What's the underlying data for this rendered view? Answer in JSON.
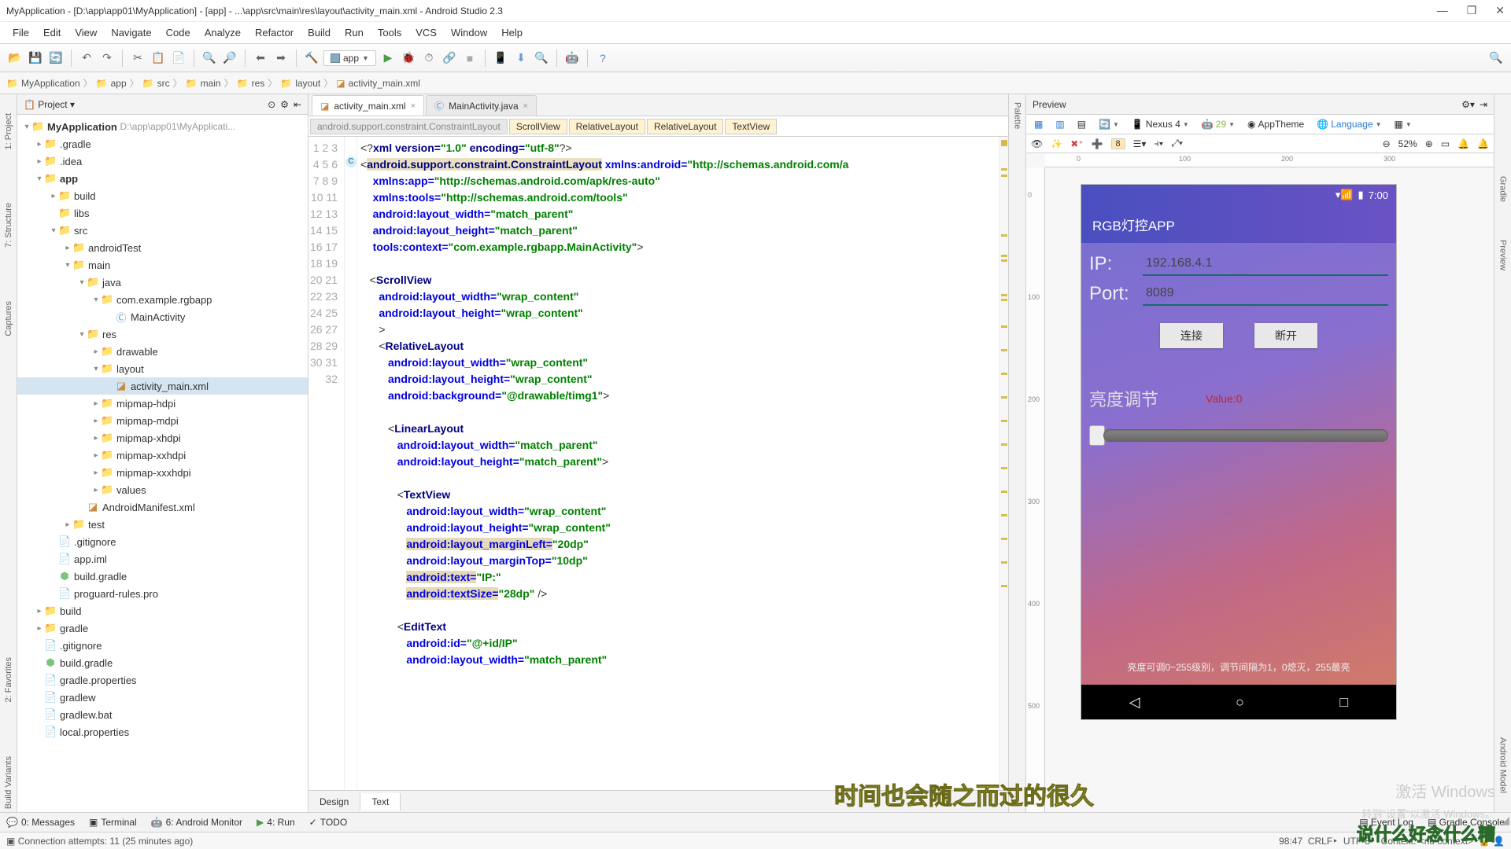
{
  "window": {
    "title": "MyApplication - [D:\\app\\app01\\MyApplication] - [app] - ...\\app\\src\\main\\res\\layout\\activity_main.xml - Android Studio 2.3",
    "min": "—",
    "max": "❐",
    "close": "✕"
  },
  "menu": [
    "File",
    "Edit",
    "View",
    "Navigate",
    "Code",
    "Analyze",
    "Refactor",
    "Build",
    "Run",
    "Tools",
    "VCS",
    "Window",
    "Help"
  ],
  "module": "app",
  "breadcrumbs": [
    "MyApplication",
    "app",
    "src",
    "main",
    "res",
    "layout",
    "activity_main.xml"
  ],
  "project": {
    "header": "Project",
    "root": "MyApplication",
    "rootPath": "D:\\app\\app01\\MyApplicati...",
    "items": [
      ".gradle",
      ".idea",
      "app",
      "build",
      "libs",
      "src",
      "androidTest",
      "main",
      "java",
      "com.example.rgbapp",
      "MainActivity",
      "res",
      "drawable",
      "layout",
      "activity_main.xml",
      "mipmap-hdpi",
      "mipmap-mdpi",
      "mipmap-xhdpi",
      "mipmap-xxhdpi",
      "mipmap-xxxhdpi",
      "values",
      "AndroidManifest.xml",
      "test",
      ".gitignore",
      "app.iml",
      "build.gradle",
      "proguard-rules.pro",
      "build",
      "gradle",
      ".gitignore",
      "build.gradle",
      "gradle.properties",
      "gradlew",
      "gradlew.bat",
      "local.properties"
    ]
  },
  "editorTabs": [
    {
      "label": "activity_main.xml",
      "active": true,
      "icon": "xml"
    },
    {
      "label": "MainActivity.java",
      "active": false,
      "icon": "java"
    }
  ],
  "editorCrumbs": [
    "android.support.constraint.ConstraintLayout",
    "ScrollView",
    "RelativeLayout",
    "RelativeLayout",
    "TextView"
  ],
  "designTabs": {
    "design": "Design",
    "text": "Text"
  },
  "preview": {
    "title": "Preview",
    "device": "Nexus 4",
    "api": "29",
    "theme": "AppTheme",
    "lang": "Language",
    "zoom": "52%",
    "warn": "8",
    "phone": {
      "time": "7:00",
      "appTitle": "RGB灯控APP",
      "ipLabel": "IP:",
      "ipValue": "192.168.4.1",
      "portLabel": "Port:",
      "portValue": "8089",
      "btnConnect": "连接",
      "btnDisconnect": "断开",
      "brightness": "亮度调节",
      "valueLabel": "Value:0",
      "hint": "亮度可调0~255级别，调节间隔为1，0熄灭，255最亮"
    }
  },
  "bottomTabs": {
    "messages": "0: Messages",
    "terminal": "Terminal",
    "monitor": "6: Android Monitor",
    "run": "4: Run",
    "todo": "TODO"
  },
  "status": {
    "msg": "Connection attempts: 11 (25 minutes ago)",
    "pos": "98:47",
    "le": "CRLF",
    "enc": "UTF-8",
    "context": "Context: <no context>"
  },
  "leftTabs": [
    "1: Project",
    "7: Structure",
    "Captures",
    "2: Favorites",
    "Build Variants"
  ],
  "rightTabs": [
    "Gradle",
    "Preview",
    "Android Model"
  ],
  "overlay": {
    "t1": "时间也会随之而过的很久",
    "t2": "激活 Windows",
    "t3": "转到\"设置\"以激活 Windows。",
    "t4": "说什么好念什么糟"
  }
}
